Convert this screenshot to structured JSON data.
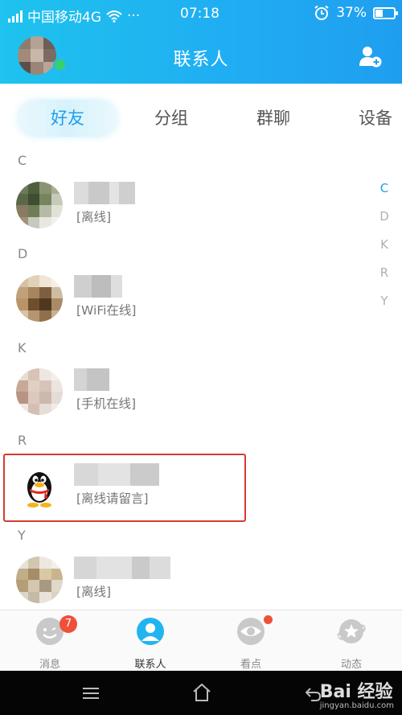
{
  "status_bar": {
    "carrier": "中国移动4G",
    "more": "···",
    "time": "07:18",
    "battery": "37%"
  },
  "nav": {
    "title": "联系人"
  },
  "tabs": [
    {
      "label": "好友",
      "active": true
    },
    {
      "label": "分组",
      "active": false
    },
    {
      "label": "群聊",
      "active": false
    },
    {
      "label": "设备",
      "active": false
    }
  ],
  "sections": [
    {
      "letter": "C",
      "contacts": [
        {
          "status": "[离线]"
        }
      ]
    },
    {
      "letter": "D",
      "contacts": [
        {
          "status": "[WiFi在线]"
        }
      ]
    },
    {
      "letter": "K",
      "contacts": [
        {
          "status": "[手机在线]"
        }
      ]
    },
    {
      "letter": "R",
      "contacts": [
        {
          "status": "[离线请留言]"
        }
      ]
    },
    {
      "letter": "Y",
      "contacts": [
        {
          "status": "[离线]"
        }
      ]
    }
  ],
  "index_bar": [
    "C",
    "D",
    "K",
    "R",
    "Y"
  ],
  "bottom_tabs": [
    {
      "label": "消息",
      "badge": "7"
    },
    {
      "label": "联系人"
    },
    {
      "label": "看点"
    },
    {
      "label": "动态"
    }
  ],
  "watermark": {
    "text": "Bai 经验",
    "url": "jingyan.baidu.com"
  },
  "colors": {
    "accent": "#1f9ef0",
    "header_start": "#1ec3ee",
    "online": "#32d26c",
    "badge": "#f0503a",
    "highlight": "#d63a32"
  }
}
